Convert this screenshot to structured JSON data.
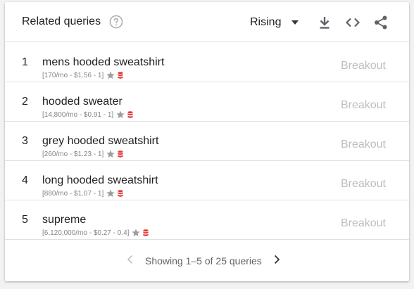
{
  "header": {
    "title": "Related queries",
    "help_icon": "help-circle-icon",
    "dropdown_value": "Rising",
    "tools": [
      "download-icon",
      "embed-code-icon",
      "share-icon"
    ]
  },
  "rows": [
    {
      "rank": "1",
      "query": "mens hooded sweatshirt",
      "meta": "[170/mo - $1.56 - 1]",
      "value": "Breakout"
    },
    {
      "rank": "2",
      "query": "hooded sweater",
      "meta": "[14,800/mo - $0.91 - 1]",
      "value": "Breakout"
    },
    {
      "rank": "3",
      "query": "grey hooded sweatshirt",
      "meta": "[260/mo - $1.23 - 1]",
      "value": "Breakout"
    },
    {
      "rank": "4",
      "query": "long hooded sweatshirt",
      "meta": "[880/mo - $1.07 - 1]",
      "value": "Breakout"
    },
    {
      "rank": "5",
      "query": "supreme",
      "meta": "[6,120,000/mo - $0.27 - 0.4]",
      "value": "Breakout"
    }
  ],
  "pagination": {
    "text": "Showing 1–5 of 25 queries"
  },
  "colors": {
    "star": "#9e9e9e",
    "database": "#e53935",
    "breakout": "#bdbdbd"
  }
}
